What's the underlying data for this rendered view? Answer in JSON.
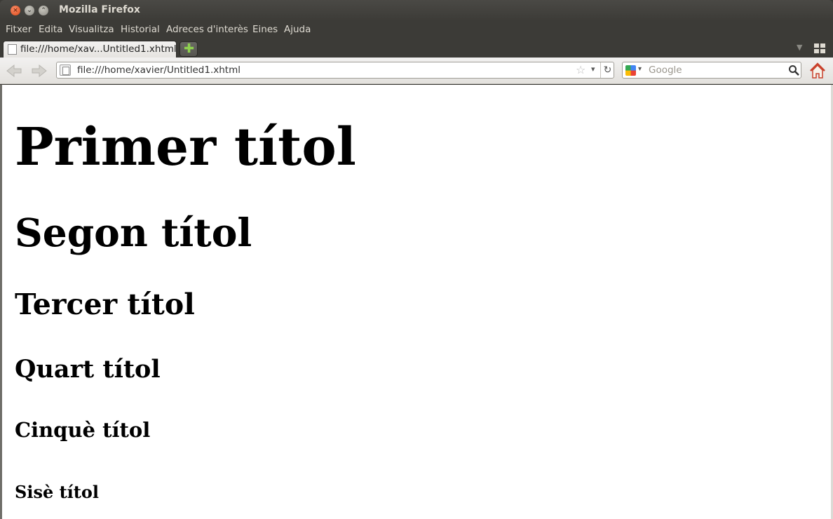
{
  "window": {
    "title": "Mozilla Firefox",
    "close_glyph": "×",
    "min_glyph": "⌄",
    "max_glyph": "⌃"
  },
  "menu": {
    "items": [
      {
        "label": "Fitxer"
      },
      {
        "label": "Edita"
      },
      {
        "label": "Visualitza"
      },
      {
        "label": "Historial"
      },
      {
        "label": "Adreces d'interès"
      },
      {
        "label": "Eines"
      },
      {
        "label": "Ajuda"
      }
    ]
  },
  "tabs": {
    "active_label": "file:///home/xav...Untitled1.xhtml",
    "new_tab_glyph": "✚",
    "list_glyph": "▼"
  },
  "toolbar": {
    "url": "file:///home/xavier/Untitled1.xhtml",
    "star_glyph": "☆",
    "url_drop_glyph": "▾",
    "reload_glyph": "↻",
    "search_drop_glyph": "▾",
    "search_placeholder": "Google"
  },
  "page": {
    "h1": "Primer títol",
    "h2": "Segon títol",
    "h3": "Tercer títol",
    "h4": "Quart títol",
    "h5": "Cinquè títol",
    "h6": "Sisè títol"
  },
  "colors": {
    "chrome_dark": "#3c3b37",
    "close_button": "#df4a16",
    "new_tab_plus": "#8fd14f",
    "home_icon": "#c9412c"
  },
  "icons": [
    "close-icon",
    "minimize-icon",
    "maximize-icon",
    "page-icon",
    "plus-icon",
    "back-arrow-icon",
    "forward-arrow-icon",
    "bookmark-star-icon",
    "reload-icon",
    "google-icon",
    "search-icon",
    "home-icon",
    "tab-groups-icon"
  ]
}
